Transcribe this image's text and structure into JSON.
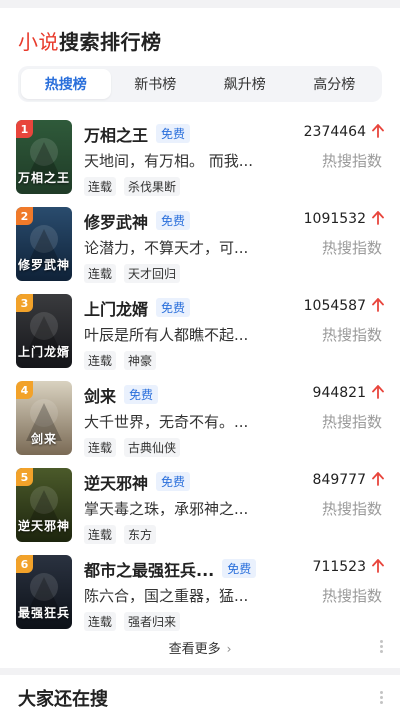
{
  "header": {
    "title_accent": "小说",
    "title_rest": "搜索排行榜"
  },
  "tabs": [
    {
      "label": "热搜榜",
      "active": true
    },
    {
      "label": "新书榜",
      "active": false
    },
    {
      "label": "飙升榜",
      "active": false
    },
    {
      "label": "高分榜",
      "active": false
    }
  ],
  "books": [
    {
      "rank": "1",
      "name": "万相之王",
      "badge": "免费",
      "desc": "天地间，有万相。 而我...",
      "tags": [
        "连载",
        "杀伐果断"
      ],
      "count": "2374464",
      "hot_label": "热搜指数",
      "cover_text": "万相之王",
      "rank_color": "#e8453c"
    },
    {
      "rank": "2",
      "name": "修罗武神",
      "badge": "免费",
      "desc": "论潜力，不算天才，可...",
      "tags": [
        "连载",
        "天才回归"
      ],
      "count": "1091532",
      "hot_label": "热搜指数",
      "cover_text": "修罗武神",
      "rank_color": "#f07a2a"
    },
    {
      "rank": "3",
      "name": "上门龙婿",
      "badge": "免费",
      "desc": "叶辰是所有人都瞧不起...",
      "tags": [
        "连载",
        "神豪"
      ],
      "count": "1054587",
      "hot_label": "热搜指数",
      "cover_text": "上门龙婿",
      "rank_color": "#f2a22a"
    },
    {
      "rank": "4",
      "name": "剑来",
      "badge": "免费",
      "desc": "大千世界，无奇不有。...",
      "tags": [
        "连载",
        "古典仙侠"
      ],
      "count": "944821",
      "hot_label": "热搜指数",
      "cover_text": "剑来",
      "rank_color": "#f2a22a"
    },
    {
      "rank": "5",
      "name": "逆天邪神",
      "badge": "免费",
      "desc": "掌天毒之珠，承邪神之...",
      "tags": [
        "连载",
        "东方"
      ],
      "count": "849777",
      "hot_label": "热搜指数",
      "cover_text": "逆天邪神",
      "rank_color": "#f2a22a"
    },
    {
      "rank": "6",
      "name": "都市之最强狂兵...",
      "badge": "免费",
      "desc": "陈六合，国之重器，猛...",
      "tags": [
        "连载",
        "强者归来"
      ],
      "count": "711523",
      "hot_label": "热搜指数",
      "cover_text": "最强狂兵",
      "rank_color": "#f2a22a"
    }
  ],
  "more": {
    "label": "查看更多",
    "chevron": "›"
  },
  "section2": {
    "title": "大家还在搜"
  },
  "colors": {
    "accent_red": "#e83b2c",
    "accent_blue": "#2a6fdb",
    "up_arrow": "#e8453c"
  }
}
